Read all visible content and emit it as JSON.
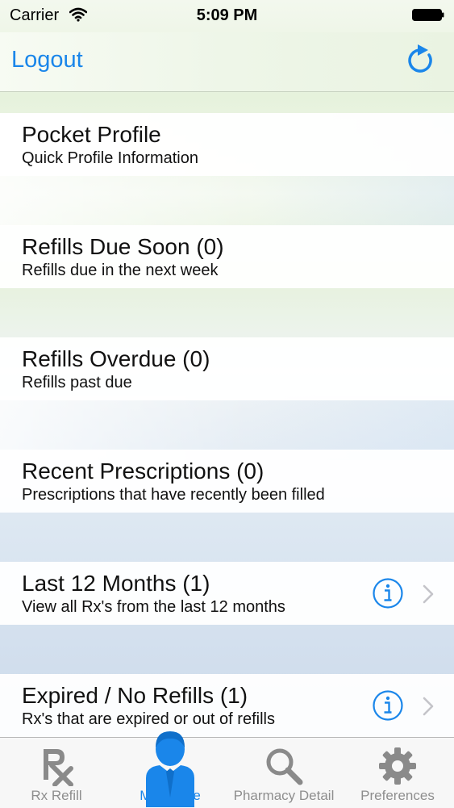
{
  "status_bar": {
    "carrier": "Carrier",
    "time": "5:09 PM"
  },
  "nav_bar": {
    "logout_label": "Logout"
  },
  "rows": [
    {
      "title": "Pocket Profile",
      "subtitle": "Quick Profile Information"
    },
    {
      "title": "Refills Due Soon (0)",
      "subtitle": "Refills due in the next week"
    },
    {
      "title": "Refills Overdue (0)",
      "subtitle": "Refills past due"
    },
    {
      "title": "Recent Prescriptions (0)",
      "subtitle": "Prescriptions that have recently been filled"
    },
    {
      "title": "Last 12 Months (1)",
      "subtitle": "View all Rx's from the last 12 months"
    },
    {
      "title": "Expired / No Refills (1)",
      "subtitle": "Rx's that are expired or out of refills"
    }
  ],
  "tabs": [
    {
      "label": "Rx Refill",
      "icon": "rx-icon"
    },
    {
      "label": "My Profile",
      "icon": "profile-icon"
    },
    {
      "label": "Pharmacy Detail",
      "icon": "search-icon"
    },
    {
      "label": "Preferences",
      "icon": "gear-icon"
    }
  ],
  "colors": {
    "accent": "#1a86ea",
    "tab_inactive": "#8e8e8e"
  }
}
